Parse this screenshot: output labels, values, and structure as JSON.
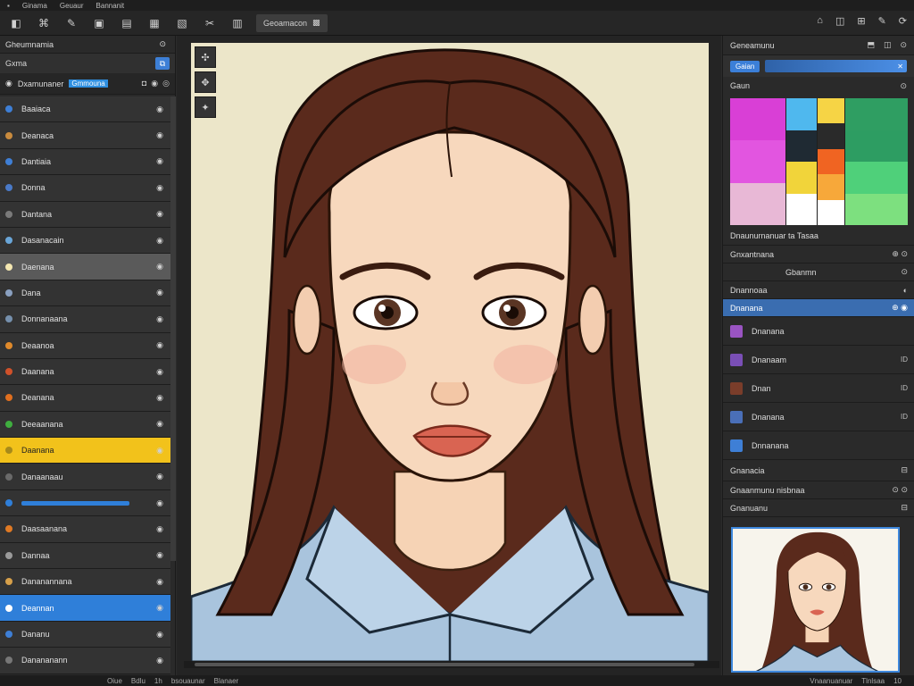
{
  "menubar": {
    "items": [
      "▪",
      "Ginama",
      "Geuaur",
      "Bannanit"
    ]
  },
  "toolbar": {
    "left_icons": [
      "◧",
      "⌘",
      "✎",
      "▣",
      "▤",
      "▦",
      "▧",
      "✂",
      "▥"
    ],
    "doc_tab": "Geoamacon",
    "doc_icon": "▩",
    "right_icons": [
      "⌂",
      "◫",
      "⊞",
      "✎",
      "⟳"
    ]
  },
  "left_panel": {
    "title": "Gheumnamia",
    "sub_label": "Gxma",
    "search_label": "Dxamunaner",
    "search_highlight": "Gmmouna",
    "layers": [
      {
        "name": "Baaiaca",
        "dot": "#3e7fd6",
        "state": "normal"
      },
      {
        "name": "Deanaca",
        "dot": "#c98b3e",
        "state": "normal"
      },
      {
        "name": "Dantiaia",
        "dot": "#3f7fd5",
        "state": "normal"
      },
      {
        "name": "Donna",
        "dot": "#4a7ac8",
        "state": "normal"
      },
      {
        "name": "Dantana",
        "dot": "#7a7a7a",
        "state": "normal"
      },
      {
        "name": "Dasanacain",
        "dot": "#6aa6d8",
        "state": "normal"
      },
      {
        "name": "Daenana",
        "dot": "#f4e7b1",
        "state": "grey"
      },
      {
        "name": "Dana",
        "dot": "#8aa0c0",
        "state": "normal"
      },
      {
        "name": "Donnanaana",
        "dot": "#7690ad",
        "state": "normal"
      },
      {
        "name": "Deaanoa",
        "dot": "#e08a2b",
        "state": "normal"
      },
      {
        "name": "Daanana",
        "dot": "#d0512a",
        "state": "normal"
      },
      {
        "name": "Deanana",
        "dot": "#e06f1f",
        "state": "normal"
      },
      {
        "name": "Deeaanana",
        "dot": "#3fae3f",
        "state": "normal"
      },
      {
        "name": "Daanana",
        "dot": "#a78a1a",
        "state": "yellow"
      },
      {
        "name": "Danaanaau",
        "dot": "#6a6a6a",
        "state": "normal"
      },
      {
        "name": "",
        "dot": "#2f7fd9",
        "state": "bluebar"
      },
      {
        "name": "Daasaanana",
        "dot": "#e07a24",
        "state": "normal"
      },
      {
        "name": "Dannaa",
        "dot": "#9a9a9a",
        "state": "normal"
      },
      {
        "name": "Dananannana",
        "dot": "#d7a04a",
        "state": "normal"
      },
      {
        "name": "Deannan",
        "dot": "#ffffff",
        "state": "blue"
      },
      {
        "name": "Dananu",
        "dot": "#3e7fd6",
        "state": "normal"
      },
      {
        "name": "Danananann",
        "dot": "#777777",
        "state": "normal"
      }
    ],
    "eye_icon": "◉"
  },
  "canvas": {
    "tools": [
      "✣",
      "✥",
      "✦"
    ]
  },
  "right_panel": {
    "title": "Geneamunu",
    "tab_label": "Gaian",
    "slider_icon": "✕",
    "swatches_label": "Gaun",
    "swatch_columns": [
      [
        "#d93fd6",
        "#e255e0",
        "#e8b8d6"
      ],
      [
        "#4fb8ee",
        "#1f2a33",
        "#f1d43a",
        "#ffffff"
      ],
      [
        "#f6d445",
        "#2a2a2a",
        "#f06422",
        "#f7a83a",
        "#ffffff"
      ],
      [
        "#2f9e62",
        "#2d9d62",
        "#4fd07a",
        "#7de07f"
      ]
    ],
    "info_line": "Dnaunurnanuar ta Tasaa",
    "section2": "Gnxantnana",
    "sub_row": "Gbanmn",
    "sub_row2": "Dnannoaa",
    "selected_row": "Dnanana",
    "list": [
      {
        "name": "Dnanana",
        "color": "#9a54c2",
        "value": ""
      },
      {
        "name": "Dnanaam",
        "color": "#7a4fb6",
        "value": "ID"
      },
      {
        "name": "Dnan",
        "color": "#7a3d2a",
        "value": "ID"
      },
      {
        "name": "Dnanana",
        "color": "#4a6fb8",
        "value": "ID"
      },
      {
        "name": "Dnnanana",
        "color": "#3e7fd6",
        "value": ""
      }
    ],
    "section3": "Gnanacia",
    "section4": "Gnaanmunu nisbnaa",
    "section5": "Gnanuanu"
  },
  "statusbar": {
    "left": [
      "Oiue",
      "Bdlu",
      "1h",
      "bsouaunar",
      "Blanaer"
    ],
    "right": [
      "Vnaanuanuar",
      "Tlnlsaa",
      "10"
    ]
  }
}
